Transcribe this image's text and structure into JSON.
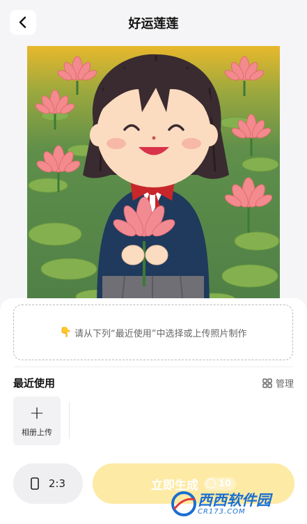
{
  "header": {
    "title": "好运莲莲",
    "back_icon": "chevron-left-icon"
  },
  "upload_hint": {
    "icon": "pointing-down-icon",
    "text": "请从下列“最近使用”中选择或上传照片制作"
  },
  "recent": {
    "title": "最近使用",
    "manage_label": "管理",
    "manage_icon": "grid-icon",
    "album_label": "相册上传"
  },
  "footer": {
    "ratio_label": "2:3",
    "ratio_icon": "phone-portrait-icon",
    "generate_label": "立即生成",
    "cost": "10"
  },
  "colors": {
    "accent": "#fdeaa4",
    "background": "#f5f5f7"
  }
}
